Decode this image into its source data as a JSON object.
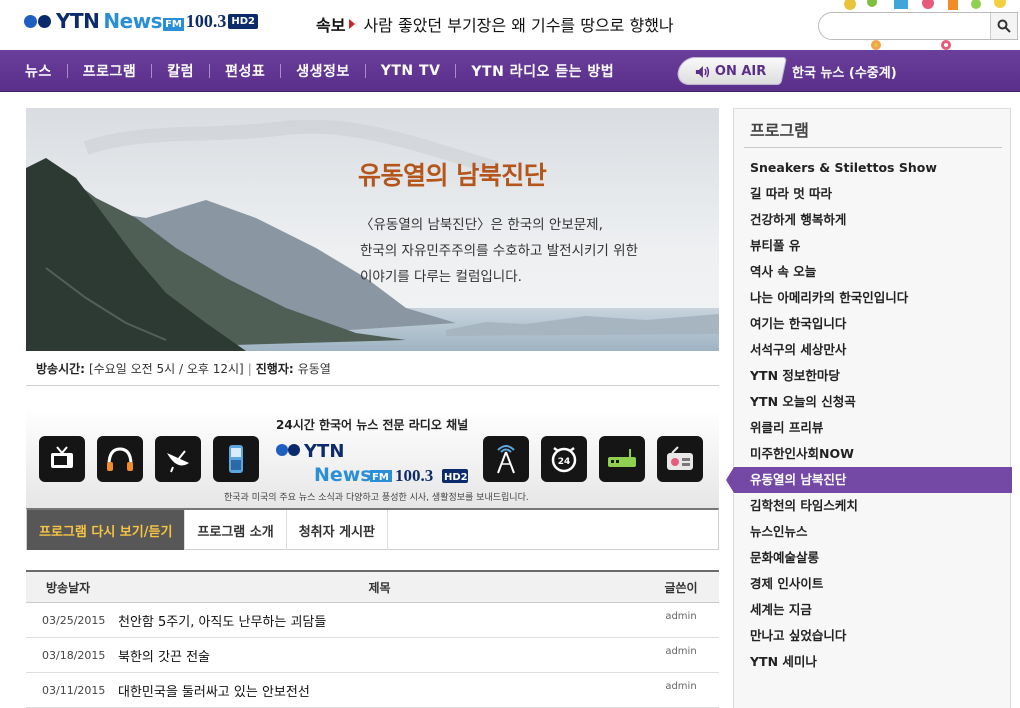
{
  "header": {
    "logo": {
      "ytn": "YTN",
      "news": "News",
      "fm": "FM",
      "freq": "100.3",
      "hd": "HD2"
    },
    "breaking_label": "속보",
    "breaking_text": "사람 좋았던 부기장은 왜 기수를 땅으로 향했나",
    "search": {
      "placeholder": ""
    }
  },
  "nav": {
    "items": [
      "뉴스",
      "프로그램",
      "칼럼",
      "편성표",
      "생생정보",
      "YTN TV",
      "YTN 라디오 듣는 방법"
    ],
    "on_air": "ON AIR",
    "now_playing": "한국 뉴스 (수중계)"
  },
  "hero": {
    "title": "유동열의 남북진단",
    "description": [
      "〈유동열의 남북진단〉은 한국의 안보문제,",
      "한국의 자유민주주의를 수호하고 발전시키기 위한",
      "이야기를 다루는 컬럼입니다."
    ]
  },
  "info": {
    "time_label": "방송시간:",
    "time_value": "[수요일 오전 5시 / 오후 12시]",
    "separator": "|",
    "host_label": "진행자:",
    "host_value": "유동열"
  },
  "banner": {
    "headline": "24시간 한국어 뉴스 전문 라디오 채널",
    "logo": {
      "ytn": "YTN",
      "news": "News",
      "fm": "FM",
      "freq": "100.3",
      "hd": "HD2"
    },
    "footer": "한국과 미국의 주요 뉴스 소식과 다양하고 풍성한 시사, 생활정보를 보내드립니다.",
    "clock_number": "24"
  },
  "tabs": [
    "프로그램 다시 보기/듣기",
    "프로그램 소개",
    "청취자 게시판"
  ],
  "table": {
    "headers": {
      "date": "방송날자",
      "title": "제목",
      "author": "글쓴이"
    },
    "rows": [
      {
        "date": "03/25/2015",
        "title": "천안함 5주기, 아직도 난무하는 괴담들",
        "author": "admin"
      },
      {
        "date": "03/18/2015",
        "title": "북한의 갓끈 전술",
        "author": "admin"
      },
      {
        "date": "03/11/2015",
        "title": "대한민국을 둘러싸고 있는 안보전선",
        "author": "admin"
      }
    ]
  },
  "sidebar": {
    "title": "프로그램",
    "items": [
      "Sneakers & Stilettos Show",
      "길 따라 멋 따라",
      "건강하게 행복하게",
      "뷰티풀 유",
      "역사 속 오늘",
      "나는 아메리카의 한국인입니다",
      "여기는 한국입니다",
      "서석구의 세상만사",
      "YTN 정보한마당",
      "YTN 오늘의 신청곡",
      "위클리 프리뷰",
      "미주한인사회NOW",
      "유동열의 남북진단",
      "김학천의 타임스케치",
      "뉴스인뉴스",
      "문화예술살롱",
      "경제 인사이트",
      "세계는 지금",
      "만나고 싶었습니다",
      "YTN 세미나"
    ],
    "active_index": 12
  },
  "colors": {
    "nav_purple": "#5a2f8a",
    "accent_orange": "#b4561b",
    "active_tab_text": "#f6c544",
    "breaking_red": "#d2232a"
  }
}
